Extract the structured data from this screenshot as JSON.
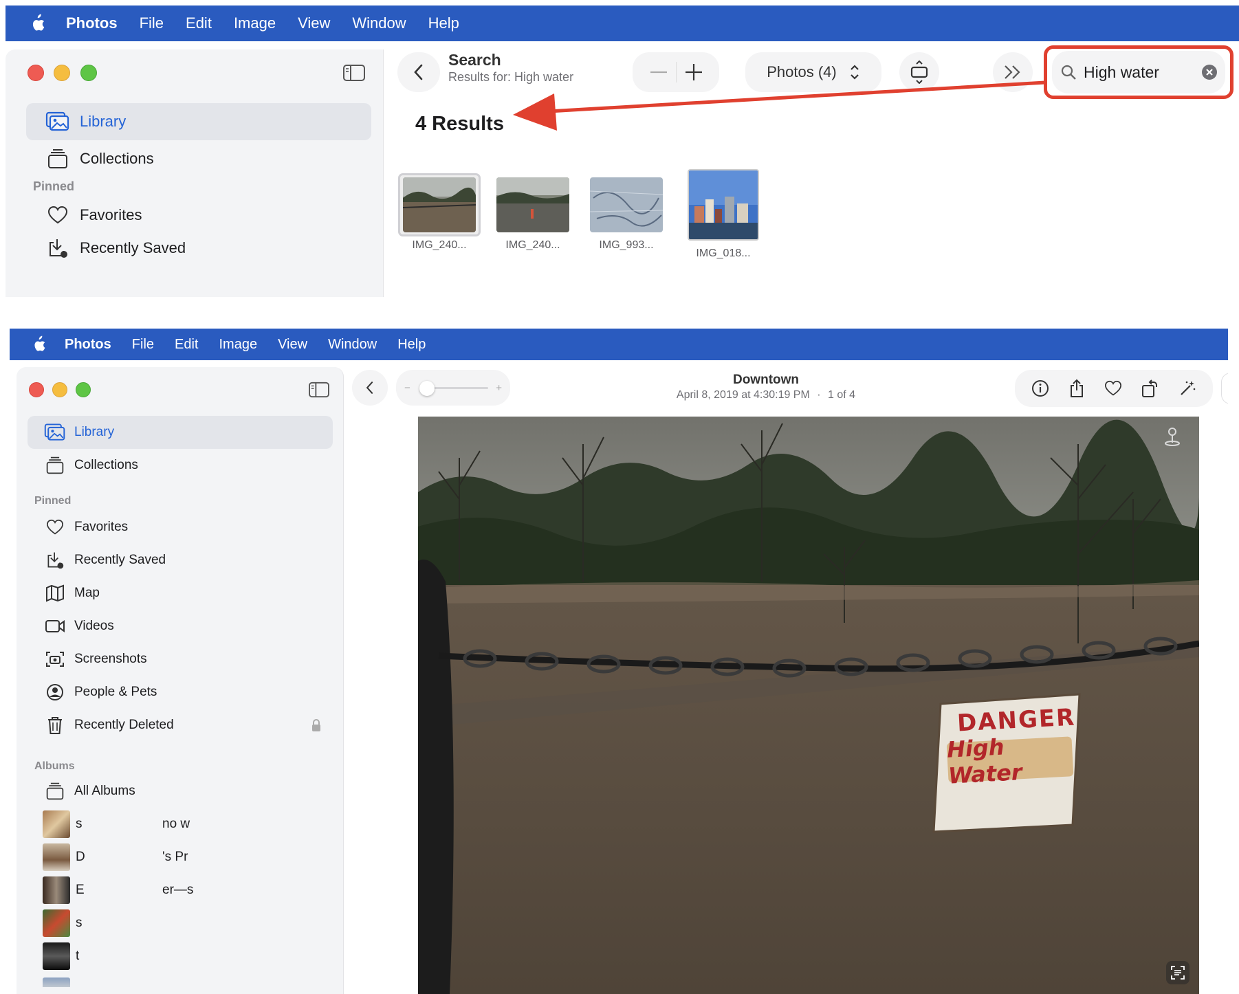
{
  "menu_items": [
    "Photos",
    "File",
    "Edit",
    "Image",
    "View",
    "Window",
    "Help"
  ],
  "top": {
    "sidebar": {
      "library": "Library",
      "collections": "Collections",
      "pinned_header": "Pinned",
      "favorites": "Favorites",
      "recently_saved": "Recently Saved"
    },
    "toolbar": {
      "title": "Search",
      "subtitle": "Results for: High water",
      "view_selector": "Photos (4)",
      "search_value": "High water"
    },
    "results_heading": "4 Results",
    "thumbnails": [
      "IMG_240...",
      "IMG_240...",
      "IMG_993...",
      "IMG_018..."
    ]
  },
  "bottom": {
    "sidebar": {
      "library": "Library",
      "collections": "Collections",
      "pinned_header": "Pinned",
      "favorites": "Favorites",
      "recently_saved": "Recently Saved",
      "map": "Map",
      "videos": "Videos",
      "screenshots": "Screenshots",
      "people_pets": "People & Pets",
      "recently_deleted": "Recently Deleted",
      "albums_header": "Albums",
      "all_albums": "All Albums",
      "album_rows": [
        {
          "left": "s",
          "right": "no w"
        },
        {
          "left": "D",
          "right": "'s Pr"
        },
        {
          "left": "E",
          "right": "er—s"
        },
        {
          "left": "s",
          "right": ""
        },
        {
          "left": "t",
          "right": ""
        }
      ]
    },
    "viewer": {
      "title": "Downtown",
      "date": "April 8, 2019 at 4:30:19 PM",
      "position": "1 of 4",
      "zoom_minus": "−",
      "zoom_plus": "+",
      "sign_line1": "DANGER",
      "sign_line2": "High Water"
    }
  },
  "colors": {
    "menubar": "#2a5bbf",
    "accent": "#2463d6",
    "highlight_box": "#e0402f",
    "arrow": "#e0402f"
  }
}
